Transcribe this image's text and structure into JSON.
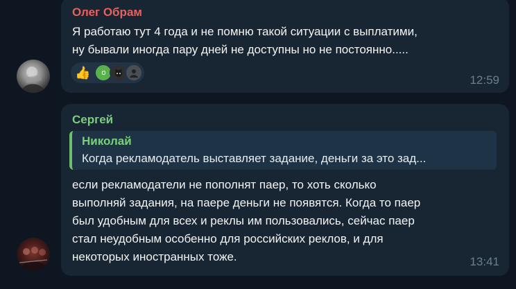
{
  "messages": [
    {
      "sender": "Олег Обрам",
      "sender_color": "#e8605d",
      "lines": [
        "Я работаю тут 4 года и не помню такой ситуации с выплатими,",
        "ну бывали  иногда пару дней не доступны но не постоянно....."
      ],
      "reactions": {
        "emoji": "thumbs-up",
        "emoji_glyph": "👍",
        "reactor_avatars": [
          "о",
          "",
          ""
        ]
      },
      "time": "12:59"
    },
    {
      "sender": "Сергей",
      "sender_color": "#7ad07a",
      "reply": {
        "name": "Николай",
        "text": "Когда рекламодатель выставляет задание, деньги за это зад..."
      },
      "lines": [
        "если рекламодатели не пополнят паер, то хоть сколько",
        "выполняй задания, на паере деньги не появятся.  Когда то паер",
        "был удобным для всех и реклы им пользовались, сейчас паер",
        "стал неудобным особенно для российских реклов, и для",
        "некоторых иностранных тоже."
      ],
      "time": "13:41"
    }
  ]
}
